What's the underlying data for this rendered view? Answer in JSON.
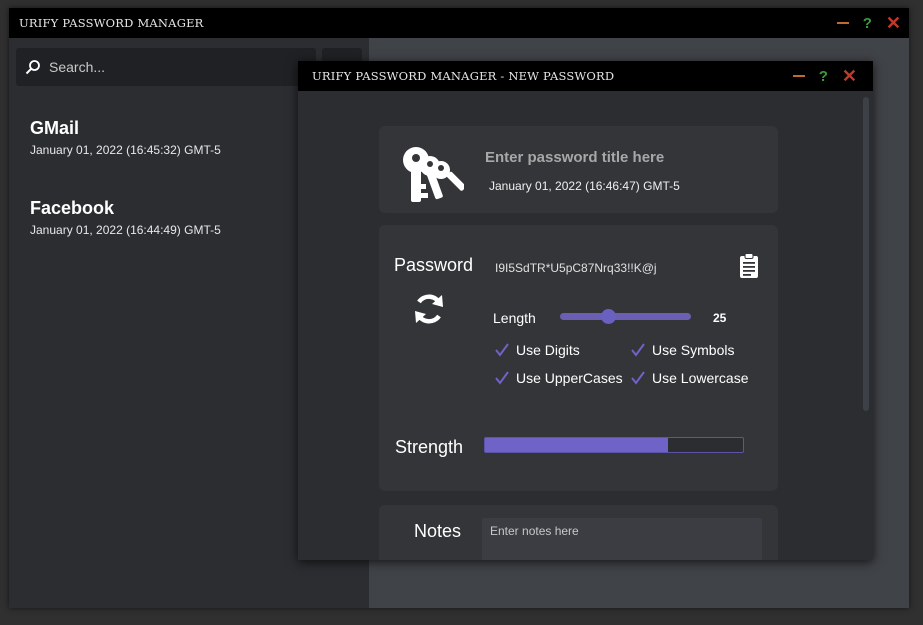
{
  "main_window": {
    "title": "URIFY PASSWORD MANAGER",
    "search": {
      "placeholder": "Search...",
      "value": ""
    },
    "entries": [
      {
        "title": "GMail",
        "date": "January 01, 2022 (16:45:32) GMT-5"
      },
      {
        "title": "Facebook",
        "date": "January 01, 2022 (16:44:49) GMT-5"
      }
    ]
  },
  "dialog": {
    "title": "URIFY PASSWORD MANAGER - NEW PASSWORD",
    "title_input": {
      "placeholder": "Enter password title here",
      "value": ""
    },
    "date": "January 01, 2022 (16:46:47) GMT-5",
    "password_label": "Password",
    "password_value": "I9I5SdTR*U5pC87Nrq33!!K@j",
    "length_label": "Length",
    "length_value": "25",
    "length_slider_fraction": 0.37,
    "options": {
      "digits": {
        "label": "Use Digits",
        "checked": true
      },
      "symbols": {
        "label": "Use Symbols",
        "checked": true
      },
      "uppercase": {
        "label": "Use UpperCases",
        "checked": true
      },
      "lowercase": {
        "label": "Use Lowercase",
        "checked": true
      }
    },
    "strength_label": "Strength",
    "strength_fraction": 0.71,
    "notes_label": "Notes",
    "notes": {
      "placeholder": "Enter notes here",
      "value": ""
    }
  },
  "icons": {
    "search": "search-icon",
    "keys": "keys-icon",
    "clipboard": "clipboard-icon",
    "refresh": "refresh-icon",
    "check": "check-icon"
  },
  "colors": {
    "accent": "#7063c7",
    "titlebar": "#000000",
    "minimize": "#c26a2c",
    "help": "#3c9a3c",
    "close": "#c0392b"
  }
}
